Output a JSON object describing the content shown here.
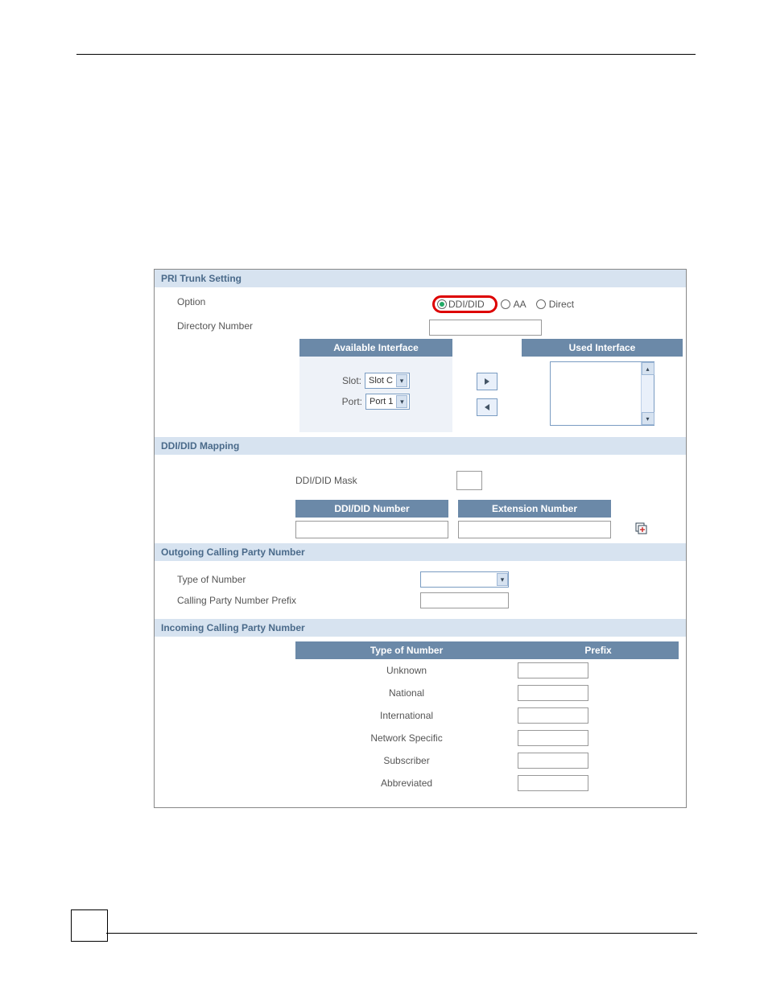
{
  "pri_trunk": {
    "title": "PRI Trunk Setting",
    "option_label": "Option",
    "directory_label": "Directory Number",
    "options": {
      "ddi": "DDI/DID",
      "aa": "AA",
      "direct": "Direct"
    },
    "available_hdr": "Available Interface",
    "used_hdr": "Used Interface",
    "slot_label": "Slot:",
    "port_label": "Port:",
    "slot_value": "Slot C",
    "port_value": "Port 1"
  },
  "ddi_mapping": {
    "title": "DDI/DID Mapping",
    "mask_label": "DDI/DID Mask",
    "ddi_number_hdr": "DDI/DID Number",
    "ext_number_hdr": "Extension Number"
  },
  "ocpn": {
    "title": "Outgoing Calling Party Number",
    "type_label": "Type of Number",
    "prefix_label": "Calling Party Number Prefix"
  },
  "icpn": {
    "title": "Incoming Calling Party Number",
    "type_hdr": "Type of Number",
    "prefix_hdr": "Prefix",
    "rows": [
      "Unknown",
      "National",
      "International",
      "Network Specific",
      "Subscriber",
      "Abbreviated"
    ]
  },
  "icons": {
    "right_arrow": "▶",
    "left_arrow": "◀",
    "down_caret": "▾",
    "up_caret": "▴"
  }
}
